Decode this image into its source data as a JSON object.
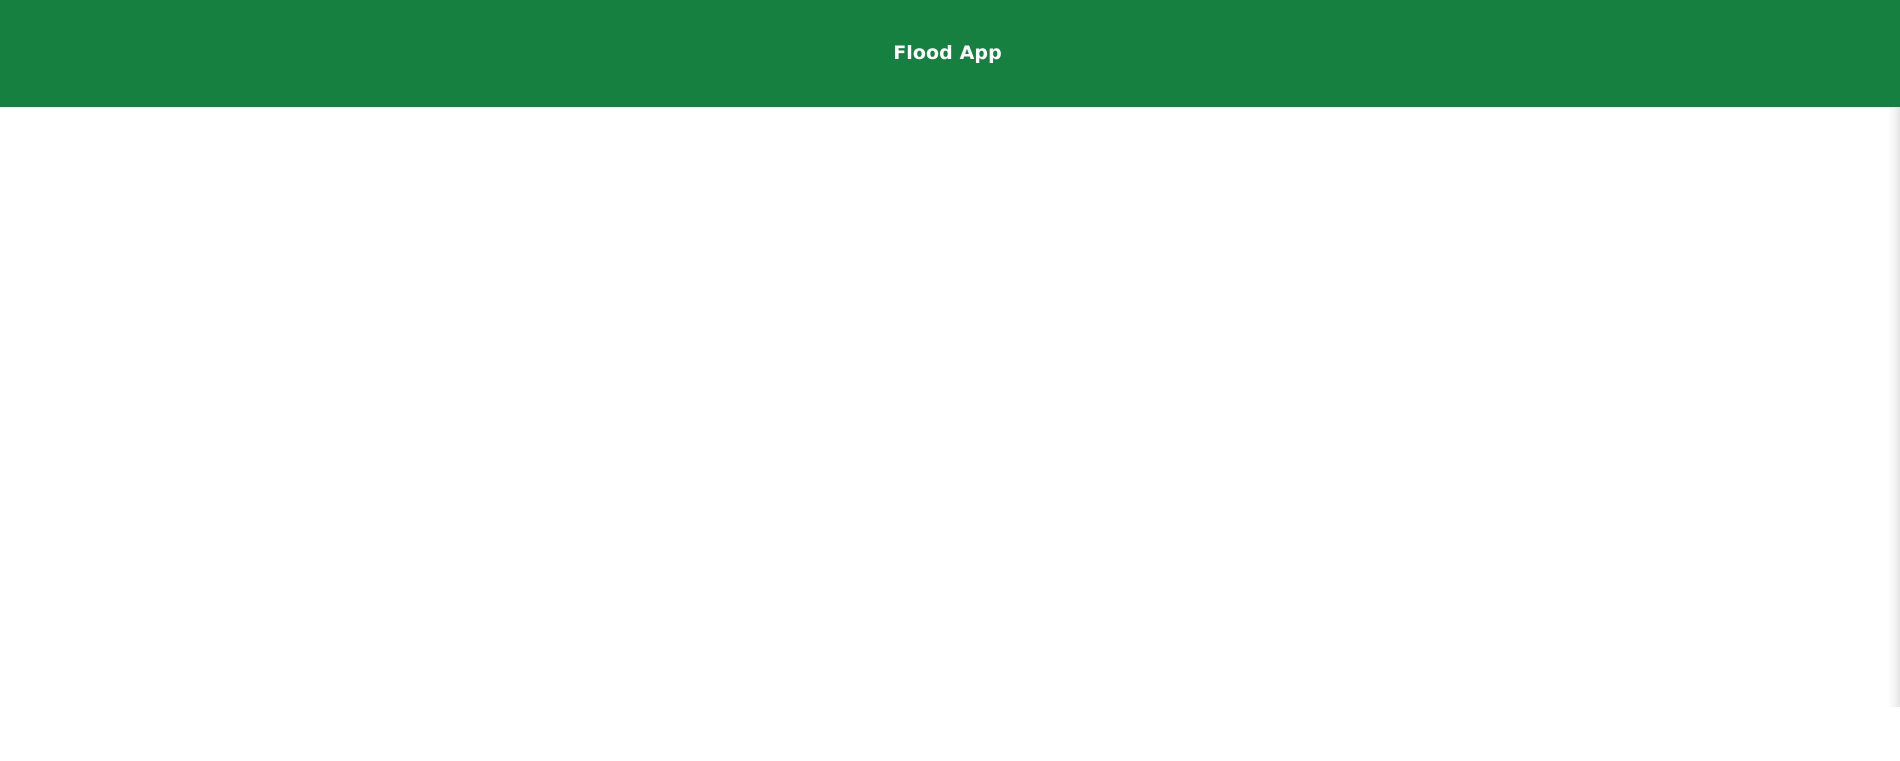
{
  "header": {
    "title": "Flood App",
    "background_color": "#168040",
    "text_color": "#ffffff"
  },
  "main": {
    "background_color": "#ffffff"
  }
}
